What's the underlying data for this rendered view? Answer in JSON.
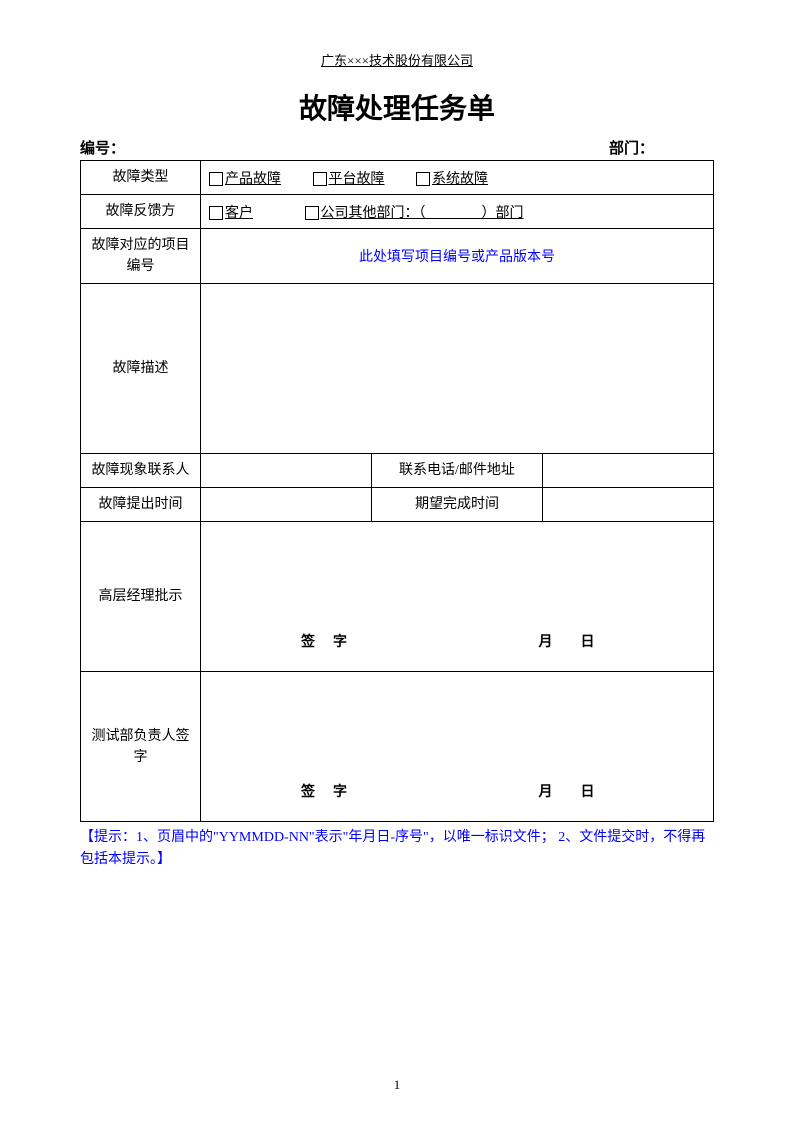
{
  "header": {
    "company": "广东×××技术股份有限公司"
  },
  "title": "故障处理任务单",
  "meta": {
    "serial_label": "编号：",
    "dept_label": "部门："
  },
  "rows": {
    "fault_type": {
      "label": "故障类型",
      "opt1": "产品故障",
      "opt2": "平台故障",
      "opt3": "系统故障"
    },
    "feedback_src": {
      "label": "故障反馈方",
      "opt1": "客户",
      "opt2": "公司其他部门：（　　　　）部门"
    },
    "project_no": {
      "label": "故障对应的项目编号",
      "hint": "此处填写项目编号或产品版本号"
    },
    "description": {
      "label": "故障描述"
    },
    "contact": {
      "label": "故障现象联系人",
      "phone_label": "联系电话/邮件地址"
    },
    "time": {
      "label": "故障提出时间",
      "expect_label": "期望完成时间"
    },
    "manager": {
      "label": "高层经理批示"
    },
    "tester": {
      "label": "测试部负责人签字"
    }
  },
  "sign": {
    "sig_label": "签　字",
    "month": "月",
    "day": "日"
  },
  "note": "【提示：1、页眉中的\"YYMMDD-NN\"表示\"年月日-序号\"，以唯一标识文件； 2、文件提交时，不得再包括本提示。】",
  "page_num": "1"
}
